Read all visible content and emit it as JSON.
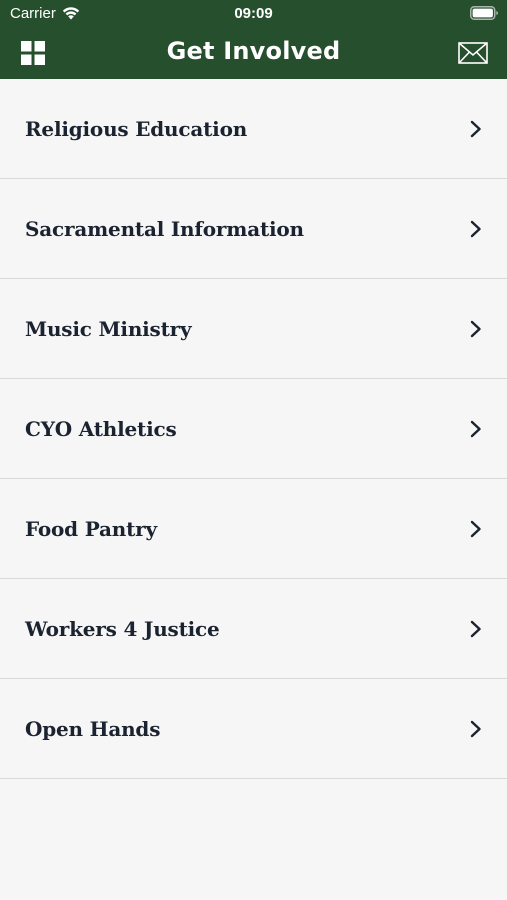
{
  "status_bar": {
    "carrier": "Carrier",
    "time": "09:09",
    "icons": [
      "wifi-icon",
      "battery-icon"
    ]
  },
  "header": {
    "title": "Get Involved",
    "left_icon": "grid-icon",
    "right_icon": "mail-icon",
    "background_color": "#264f2d"
  },
  "list": {
    "items": [
      {
        "label": "Religious Education"
      },
      {
        "label": "Sacramental Information"
      },
      {
        "label": "Music Ministry"
      },
      {
        "label": "CYO Athletics"
      },
      {
        "label": "Food Pantry"
      },
      {
        "label": "Workers 4 Justice"
      },
      {
        "label": "Open Hands"
      }
    ],
    "item_icon": "chevron-right-icon"
  }
}
